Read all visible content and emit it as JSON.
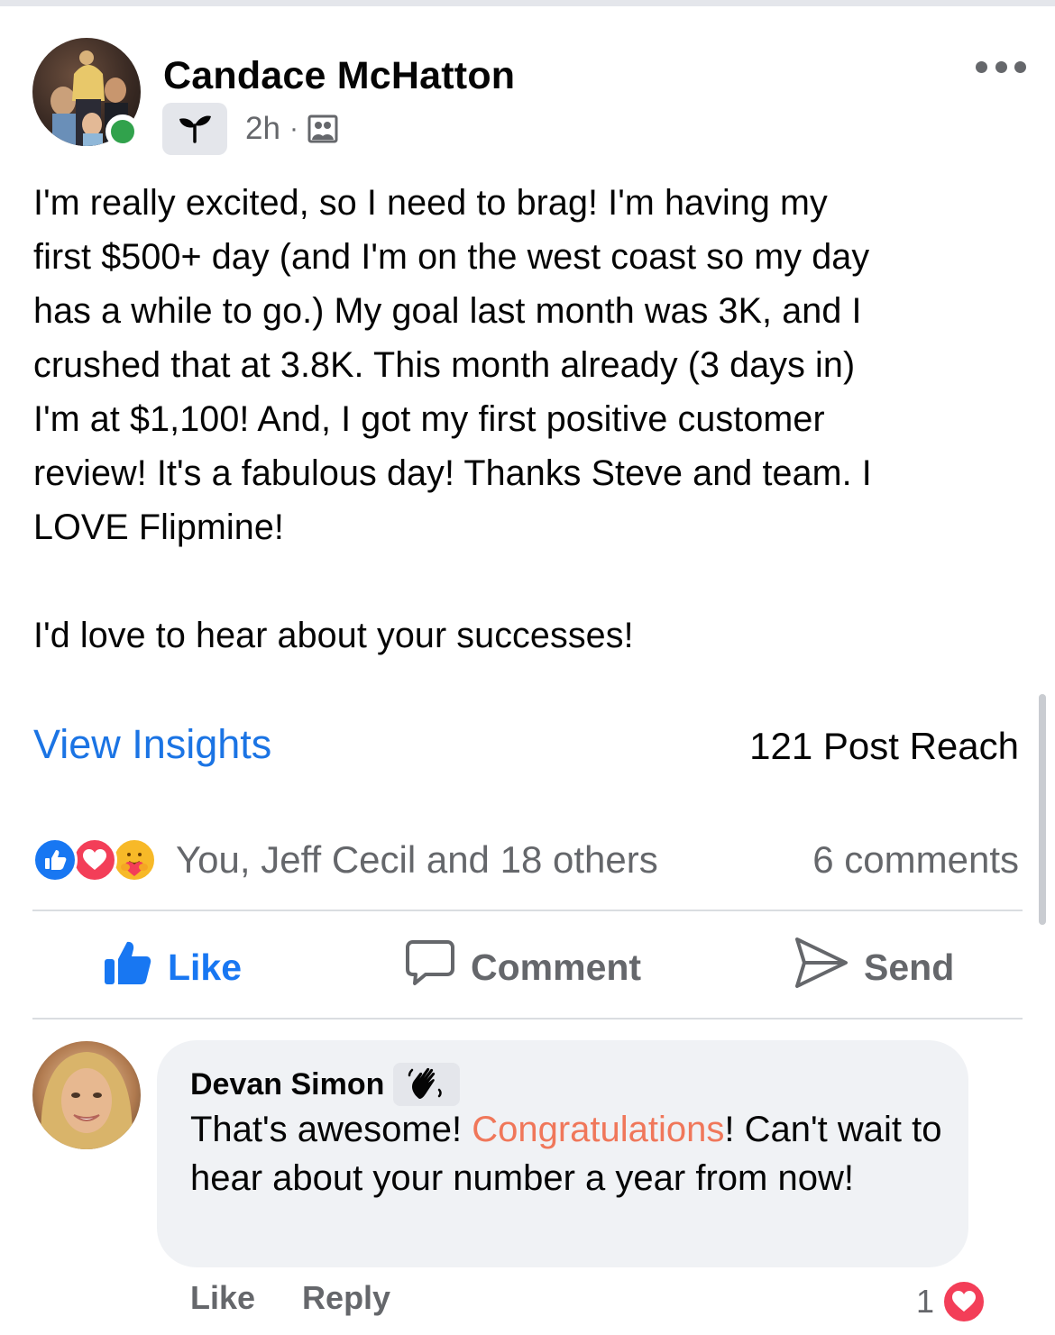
{
  "post": {
    "author": "Candace McHatton",
    "time": "2h",
    "separator": "·",
    "badge_icon": "new-member-sprout-icon",
    "audience_icon": "group-audience-icon",
    "body": "I'm really excited, so I need to brag! I'm having my\nfirst $500+ day (and I'm on the west coast so my day\nhas a while to go.) My goal last month was 3K, and I\ncrushed that at 3.8K. This month already (3 days in)\nI'm at $1,100! And, I got my first positive customer\nreview! It's a fabulous day! Thanks Steve and team. I\nLOVE Flipmine!\n\nI'd love to hear about your successes!",
    "view_insights": "View Insights",
    "post_reach": "121 Post Reach",
    "reactions_text": "You, Jeff Cecil and 18 others",
    "comments_count": "6 comments"
  },
  "actions": {
    "like": "Like",
    "comment": "Comment",
    "send": "Send"
  },
  "comment": {
    "author": "Devan Simon",
    "badge_icon": "waving-hand-icon",
    "text_before": "That's awesome! ",
    "highlight": "Congratulations",
    "text_after": "! Can't wait to hear about your number a year from now!",
    "like": "Like",
    "reply": "Reply",
    "reaction_count": "1"
  },
  "colors": {
    "link_blue": "#1b74e4",
    "like_blue": "#1877f2",
    "love_red": "#f33e58",
    "care_yellow": "#f7b928",
    "online_green": "#31a24c",
    "highlight_orange": "#f0775a",
    "secondary_text": "#65676b"
  }
}
